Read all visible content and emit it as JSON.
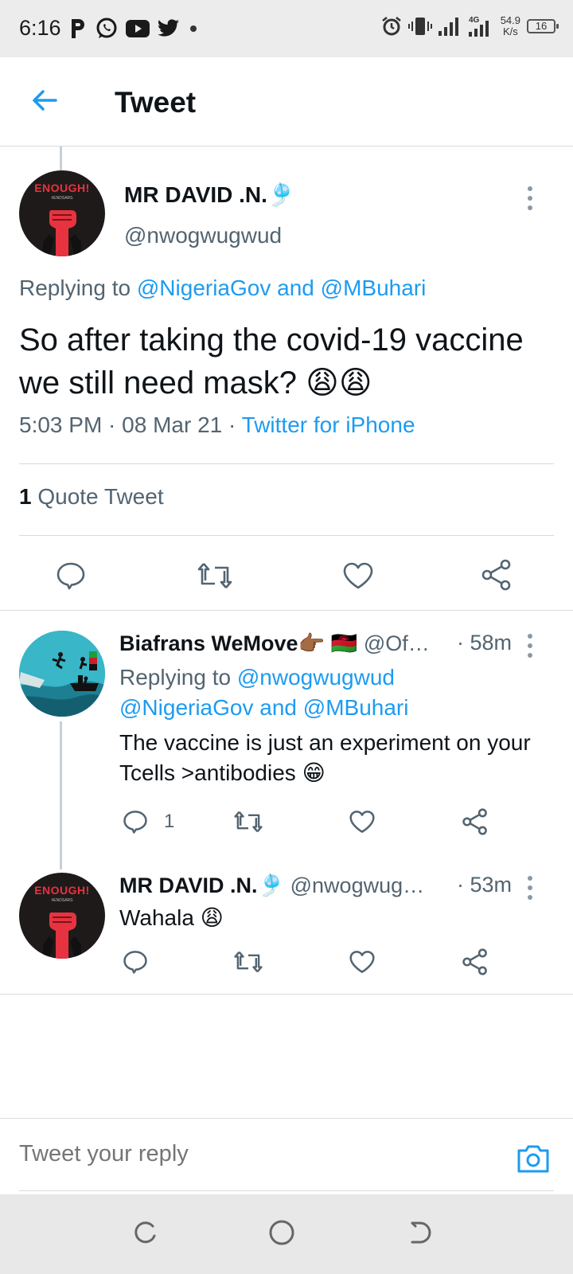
{
  "status_bar": {
    "time": "6:16",
    "net_speed_value": "54.9",
    "net_speed_unit": "K/s",
    "network_type": "4G",
    "battery": "16",
    "left_icons": [
      "p-app-icon",
      "whatsapp-icon",
      "youtube-icon",
      "twitter-icon",
      "dot-icon"
    ],
    "right_icons": [
      "alarm-icon",
      "vibrate-icon",
      "signal-icon",
      "signal-4g-icon",
      "battery-icon"
    ]
  },
  "header": {
    "title": "Tweet",
    "back_icon": "arrow-left-icon"
  },
  "main_tweet": {
    "name": "MR DAVID .N.🎐",
    "handle": "@nwogwugwud",
    "avatar_text": "ENOUGH!",
    "avatar_tag": "#ENDSARS",
    "replying_prefix": "Replying to ",
    "replying_user1": "@NigeriaGov",
    "replying_and": " and ",
    "replying_user2": "@MBuhari",
    "text": "So after taking the covid-19 vaccine we still need mask? 😩😩",
    "time": "5:03 PM",
    "sep": " · ",
    "date": "08 Mar 21",
    "source": "Twitter for iPhone",
    "quote_count": "1",
    "quote_label": " Quote Tweet"
  },
  "replies": [
    {
      "name": "Biafrans WeMove👉🏾 🇲🇼",
      "handle": " @Of…",
      "time": "· 58m",
      "replying_prefix": "Replying to ",
      "replying_user1": "@nwogwugwud",
      "replying_user2": "@NigeriaGov",
      "replying_and": " and ",
      "replying_user3": "@MBuhari",
      "text": "The vaccine is just an experiment on your Tcells >antibodies 😁",
      "reply_count": "1"
    },
    {
      "name": "MR DAVID .N.🎐",
      "handle": " @nwogwug…",
      "time": "· 53m",
      "text": "Wahala 😩"
    }
  ],
  "composer": {
    "placeholder": "Tweet your reply",
    "camera_icon": "camera-icon"
  },
  "nav_bar": {
    "icons": [
      "recents-icon",
      "home-icon",
      "back-icon"
    ]
  },
  "colors": {
    "accent": "#1d9bf0",
    "secondary_text": "#536471",
    "divider": "#d6dbdf"
  }
}
